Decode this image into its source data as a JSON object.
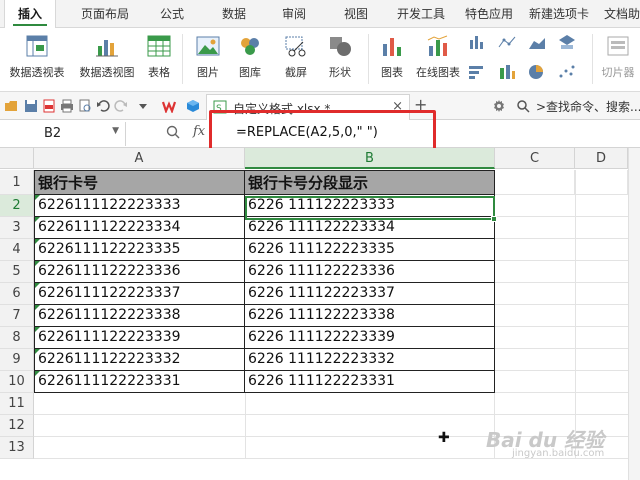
{
  "ribbon_tabs": [
    "插入",
    "页面布局",
    "公式",
    "数据",
    "审阅",
    "视图",
    "开发工具",
    "特色应用",
    "新建选项卡",
    "文档助"
  ],
  "active_tab": "插入",
  "ribbon_buttons": {
    "pivot_table": "数据透视表",
    "pivot_chart": "数据透视图",
    "table": "表格",
    "picture": "图片",
    "gallery": "图库",
    "screenshot": "截屏",
    "shapes": "形状",
    "chart": "图表",
    "online_chart": "在线图表",
    "slicer": "切片器"
  },
  "document": {
    "filename": "自定义格式.xlsx *",
    "close": "×",
    "new_tab": "+"
  },
  "search": {
    "text": ">查找命令、搜索..."
  },
  "formula_bar": {
    "cell_ref": "B2",
    "fx": "fx",
    "formula": "=REPLACE(A2,5,0,\" \")"
  },
  "columns": [
    "A",
    "B",
    "C",
    "D"
  ],
  "rows": [
    "1",
    "2",
    "3",
    "4",
    "5",
    "6",
    "7",
    "8",
    "9",
    "10",
    "11",
    "12",
    "13"
  ],
  "table": {
    "headers": [
      "银行卡号",
      "银行卡号分段显示"
    ],
    "col_a": [
      "6226111122223333",
      "6226111122223334",
      "6226111122223335",
      "6226111122223336",
      "6226111122223337",
      "6226111122223338",
      "6226111122223339",
      "6226111122223332",
      "6226111122223331"
    ],
    "col_b": [
      "6226 111122223333",
      "6226 111122223334",
      "6226 111122223335",
      "6226 111122223336",
      "6226 111122223337",
      "6226 111122223338",
      "6226 111122223339",
      "6226 111122223332",
      "6226 111122223331"
    ]
  },
  "watermark": {
    "main": "Bai du 经验",
    "sub": "jingyan.baidu.com"
  },
  "colors": {
    "accent": "#2f8a3f",
    "highlight_box": "#e02b2b",
    "header_fill": "#a6a6a6"
  }
}
